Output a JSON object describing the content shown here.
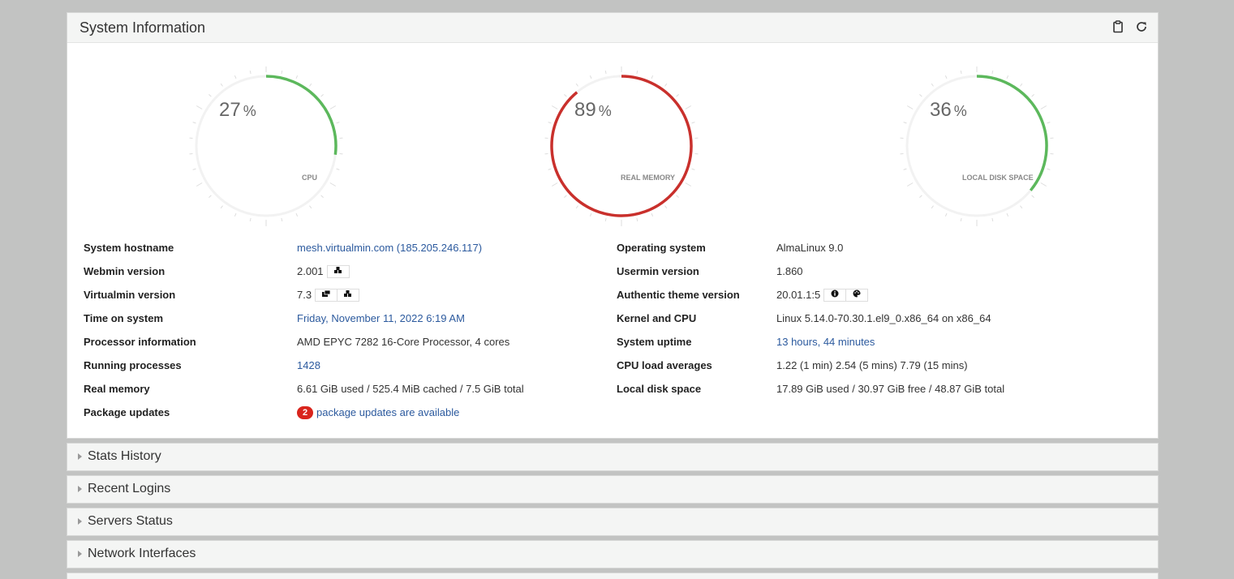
{
  "panel": {
    "title": "System Information",
    "actions": [
      {
        "icon": "clipboard-icon"
      },
      {
        "icon": "refresh-icon"
      }
    ]
  },
  "gauges": [
    {
      "name": "cpu",
      "value": "27",
      "unit": "%",
      "label": "CPU",
      "fraction": 0.27,
      "color": "#5cb85c"
    },
    {
      "name": "real-memory",
      "value": "89",
      "unit": "%",
      "label": "REAL MEMORY",
      "fraction": 0.89,
      "color": "#c9302c"
    },
    {
      "name": "local-disk-space",
      "value": "36",
      "unit": "%",
      "label": "LOCAL DISK SPACE",
      "fraction": 0.36,
      "color": "#5cb85c"
    }
  ],
  "left_info": [
    {
      "label": "System hostname",
      "value": "mesh.virtualmin.com (185.205.246.117)"
    },
    {
      "label": "Webmin version",
      "value": "2.001"
    },
    {
      "label": "Virtualmin version",
      "value": "7.3"
    },
    {
      "label": "Time on system",
      "value": "Friday, November 11, 2022 6:19 AM"
    },
    {
      "label": "Processor information",
      "value": "AMD EPYC 7282 16-Core Processor, 4 cores"
    },
    {
      "label": "Running processes",
      "value": "1428"
    },
    {
      "label": "Real memory",
      "value": "6.61 GiB used / 525.4 MiB cached / 7.5 GiB total"
    },
    {
      "label": "Package updates",
      "value": "package updates are available",
      "badge": "2"
    }
  ],
  "right_info": [
    {
      "label": "Operating system",
      "value": "AlmaLinux 9.0"
    },
    {
      "label": "Usermin version",
      "value": "1.860"
    },
    {
      "label": "Authentic theme version",
      "value": "20.01.1:5"
    },
    {
      "label": "Kernel and CPU",
      "value": "Linux 5.14.0-70.30.1.el9_0.x86_64 on x86_64"
    },
    {
      "label": "System uptime",
      "value": "13 hours, 44 minutes"
    },
    {
      "label": "CPU load averages",
      "value": "1.22 (1 min) 2.54 (5 mins) 7.79 (15 mins)"
    },
    {
      "label": "Local disk space",
      "value": "17.89 GiB used / 30.97 GiB free / 48.87 GiB total"
    }
  ],
  "sections": [
    {
      "title": "Stats History"
    },
    {
      "title": "Recent Logins"
    },
    {
      "title": "Servers Status"
    },
    {
      "title": "Network Interfaces"
    }
  ],
  "colors": {
    "link": "#2c5a9e",
    "badge": "#d9251d",
    "ok": "#5cb85c",
    "warn": "#c9302c"
  }
}
